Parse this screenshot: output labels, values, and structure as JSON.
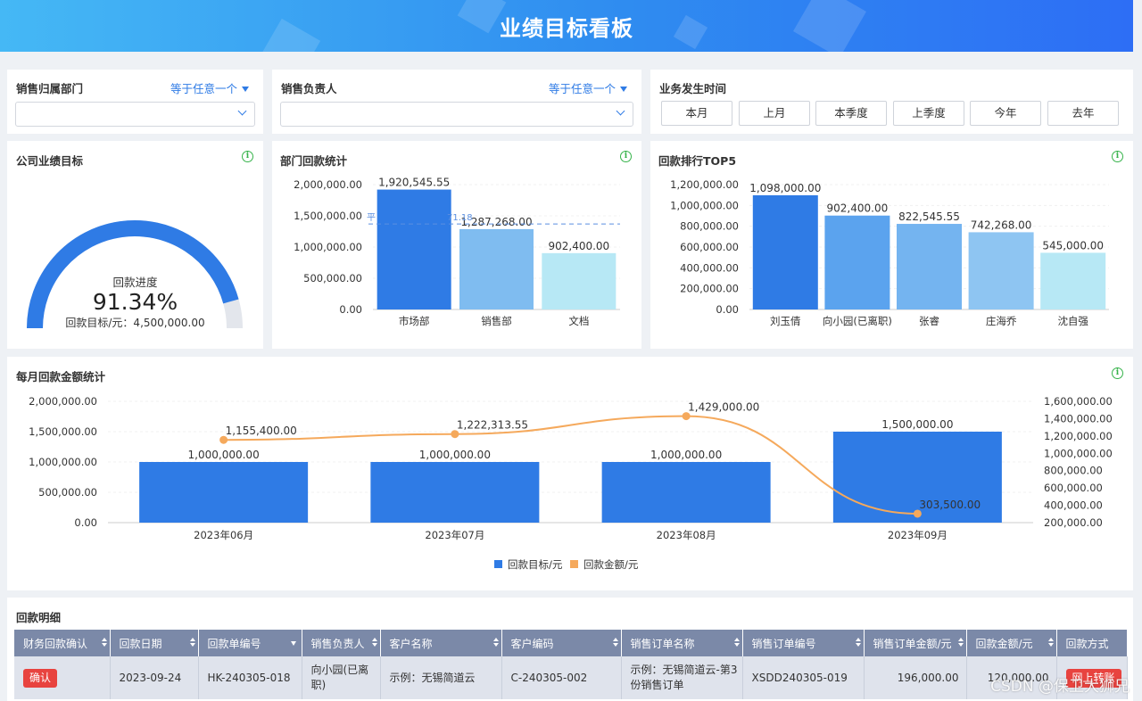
{
  "header": {
    "title": "业绩目标看板"
  },
  "filters": {
    "dept": {
      "label": "销售归属部门",
      "operator": "等于任意一个",
      "value": ""
    },
    "owner": {
      "label": "销售负责人",
      "operator": "等于任意一个",
      "value": ""
    },
    "time": {
      "label": "业务发生时间",
      "buttons": [
        "本月",
        "上月",
        "本季度",
        "上季度",
        "今年",
        "去年"
      ]
    }
  },
  "gauge_card": {
    "title": "公司业绩目标",
    "progress_label": "回款进度",
    "progress_value": "91.34%",
    "progress_fraction": 0.9134,
    "target_text": "回款目标/元：4,500,000.00",
    "colors": {
      "fill": "#2f7be5",
      "track": "#e3e6ec"
    }
  },
  "dept_card": {
    "title": "部门回款统计"
  },
  "top5_card": {
    "title": "回款排行TOP5"
  },
  "monthly_card": {
    "title": "每月回款金额统计"
  },
  "detail": {
    "title": "回款明细",
    "columns": [
      "财务回款确认",
      "回款日期",
      "回款单编号",
      "销售负责人",
      "客户名称",
      "客户编码",
      "销售订单名称",
      "销售订单编号",
      "销售订单金额/元",
      "回款金额/元",
      "回款方式"
    ],
    "rows": [
      {
        "confirm": "确认",
        "date": "2023-09-24",
        "code": "HK-240305-018",
        "owner": "向小园(已离职)",
        "customer": "示例：无锡简道云",
        "customer_code": "C-240305-002",
        "order_name": "示例：无锡简道云-第3份销售订单",
        "order_code": "XSDD240305-019",
        "order_amount": "196,000.00",
        "amount": "120,000.00",
        "method": "网上转账"
      }
    ]
  },
  "watermark": "CSDN @保卫大狮兄",
  "chart_data": [
    {
      "type": "bar",
      "categories": [
        "市场部",
        "销售部",
        "文档"
      ],
      "values": [
        1920545.55,
        1287268.0,
        902400.0
      ],
      "value_labels": [
        "1,920,545.55",
        "1,287,268.00",
        "902,400.00"
      ],
      "colors": [
        "#2f7be5",
        "#7fbcf0",
        "#b7e8f5"
      ],
      "ylim": [
        0,
        2000000
      ],
      "yticks": [
        "0.00",
        "500,000.00",
        "1,000,000.00",
        "1,500,000.00",
        "2,000,000.00"
      ],
      "average": {
        "value": 1370071.18,
        "label_visible": "平",
        "value_visible": "71.18"
      },
      "grid": true
    },
    {
      "type": "bar",
      "categories": [
        "刘玉倩",
        "向小园(已离职)",
        "张睿",
        "庄海乔",
        "沈自强"
      ],
      "values": [
        1098000.0,
        902400.0,
        822545.55,
        742268.0,
        545000.0
      ],
      "value_labels": [
        "1,098,000.00",
        "902,400.00",
        "822,545.55",
        "742,268.00",
        "545,000.00"
      ],
      "colors": [
        "#2f7be5",
        "#5ba3ee",
        "#74b4f0",
        "#8ec5f2",
        "#b7e8f5"
      ],
      "ylim": [
        0,
        1200000
      ],
      "yticks": [
        "0.00",
        "200,000.00",
        "400,000.00",
        "600,000.00",
        "800,000.00",
        "1,000,000.00",
        "1,200,000.00"
      ],
      "grid": true
    },
    {
      "type": "bar",
      "categories": [
        "2023年06月",
        "2023年07月",
        "2023年08月",
        "2023年09月"
      ],
      "series": [
        {
          "name": "回款目标/元",
          "type": "bar",
          "axis": "left",
          "color": "#2f7be5",
          "values": [
            1000000.0,
            1000000.0,
            1000000.0,
            1500000.0
          ],
          "labels": [
            "1,000,000.00",
            "1,000,000.00",
            "1,000,000.00",
            "1,500,000.00"
          ]
        },
        {
          "name": "回款金额/元",
          "type": "line",
          "axis": "right",
          "color": "#f5a95c",
          "values": [
            1155400.0,
            1222313.55,
            1429000.0,
            303500.0
          ],
          "labels": [
            "1,155,400.00",
            "1,222,313.55",
            "1,429,000.00",
            "303,500.00"
          ]
        }
      ],
      "ylim_left": [
        0,
        2000000
      ],
      "yticks_left": [
        "0.00",
        "500,000.00",
        "1,000,000.00",
        "1,500,000.00",
        "2,000,000.00"
      ],
      "ylim_right": [
        200000,
        1600000
      ],
      "yticks_right": [
        "200,000.00",
        "400,000.00",
        "600,000.00",
        "800,000.00",
        "1,000,000.00",
        "1,200,000.00",
        "1,400,000.00",
        "1,600,000.00"
      ],
      "legend": "bottom-center"
    }
  ]
}
